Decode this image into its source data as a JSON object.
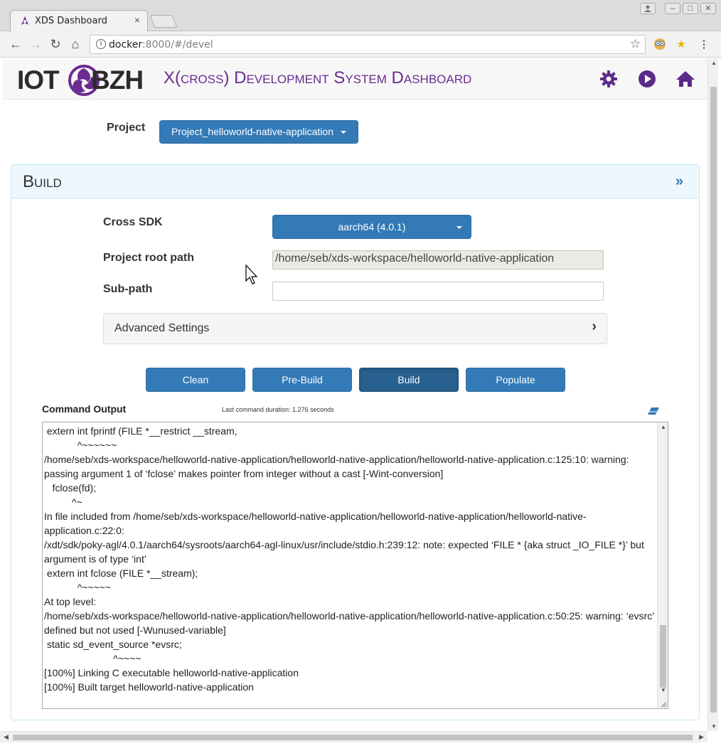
{
  "browser": {
    "tab_title": "XDS Dashboard",
    "tab_close": "×",
    "url_host": "docker",
    "url_rest": ":8000/#/devel",
    "window_minimize": "–",
    "window_maximize": "□",
    "window_close": "✕"
  },
  "header": {
    "logo_left": "IOT",
    "logo_right": "BZH",
    "title": "X(cross) Development System Dashboard",
    "accent_color": "#5a2a88"
  },
  "project": {
    "label": "Project",
    "selected": "Project_helloworld-native-application"
  },
  "build_panel": {
    "title": "Build",
    "cross_sdk_label": "Cross SDK",
    "cross_sdk_selected": "aarch64 (4.0.1)",
    "root_path_label": "Project root path",
    "root_path_value": "/home/seb/xds-workspace/helloworld-native-application",
    "subpath_label": "Sub-path",
    "subpath_value": "",
    "advanced_label": "Advanced Settings",
    "buttons": {
      "clean": "Clean",
      "prebuild": "Pre-Build",
      "build": "Build",
      "populate": "Populate"
    },
    "command_output_label": "Command Output",
    "duration": "Last command duration: 1.276 seconds",
    "output_lines": [
      " extern int fprintf (FILE *__restrict __stream,",
      "            ^~~~~~~",
      "/home/seb/xds-workspace/helloworld-native-application/helloworld-native-application/helloworld-native-application.c:125:10: warning:",
      "passing argument 1 of ‘fclose’ makes pointer from integer without a cast [-Wint-conversion]",
      "   fclose(fd);",
      "          ^~",
      "In file included from /home/seb/xds-workspace/helloworld-native-application/helloworld-native-application/helloworld-native-",
      "application.c:22:0:",
      "/xdt/sdk/poky-agl/4.0.1/aarch64/sysroots/aarch64-agl-linux/usr/include/stdio.h:239:12: note: expected ‘FILE * {aka struct _IO_FILE *}’ but",
      "argument is of type ‘int’",
      " extern int fclose (FILE *__stream);",
      "            ^~~~~~",
      "At top level:",
      "/home/seb/xds-workspace/helloworld-native-application/helloworld-native-application/helloworld-native-application.c:50:25: warning: ‘evsrc’",
      "defined but not used [-Wunused-variable]",
      " static sd_event_source *evsrc;",
      "                         ^~~~~",
      "[100%] Linking C executable helloworld-native-application",
      "[100%] Built target helloworld-native-application"
    ]
  },
  "icons": {
    "settings": "gear-icon",
    "run": "play-icon",
    "home": "home-icon",
    "collapse": "double-chevron-right-icon",
    "advanced_expand": "chevron-right-icon",
    "clear_output": "eraser-icon"
  }
}
